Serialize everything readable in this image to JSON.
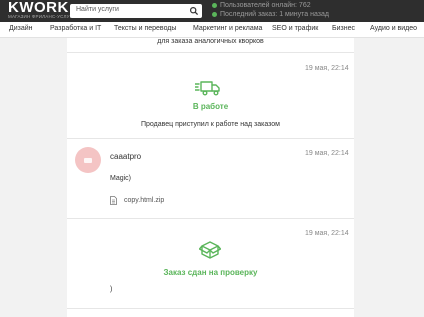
{
  "header": {
    "logo": "KWORK",
    "logo_tagline": "МАГАЗИН ФРИЛАНС-УСЛУГ",
    "search_placeholder": "Найти услуги",
    "stats": [
      "Пользователей онлайн: 762",
      "Последний заказ: 1 минута назад"
    ],
    "status_color": "#5ab55a"
  },
  "nav": {
    "items": [
      "Дизайн",
      "Разработка и IT",
      "Тексты и переводы",
      "Маркетинг и реклама",
      "SEO и трафик",
      "Бизнес",
      "Аудио и видео"
    ]
  },
  "order": {
    "top_note": "для заказа аналогичных кворков",
    "events": [
      {
        "date": "19 мая, 22:14",
        "title": "В работе",
        "description": "Продавец приступил к работе над заказом",
        "icon": "delivery-truck-icon"
      },
      {
        "date": "19 мая, 22:14",
        "username": "caaatpro",
        "message": "Magic)",
        "attachment": "copy.html.zip",
        "icon": "file-icon"
      },
      {
        "date": "19 мая, 22:14",
        "title": "Заказ сдан на проверку",
        "message": ")",
        "icon": "box-icon"
      }
    ],
    "accent_color": "#5ab55a"
  }
}
